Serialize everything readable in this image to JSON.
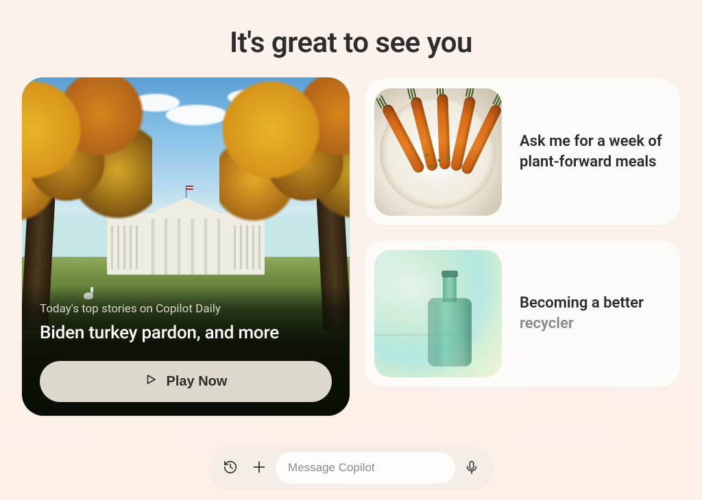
{
  "greeting": "It's great to see you",
  "daily": {
    "kicker": "Today's top stories on Copilot Daily",
    "headline": "Biden turkey pardon, and more",
    "play_label": "Play Now"
  },
  "suggestions": [
    {
      "text": "Ask me for a week of plant-forward meals",
      "muted": "",
      "image": "carrots"
    },
    {
      "text": "Becoming a better ",
      "muted": "recycler",
      "image": "bottle"
    }
  ],
  "input": {
    "placeholder": "Message Copilot"
  }
}
